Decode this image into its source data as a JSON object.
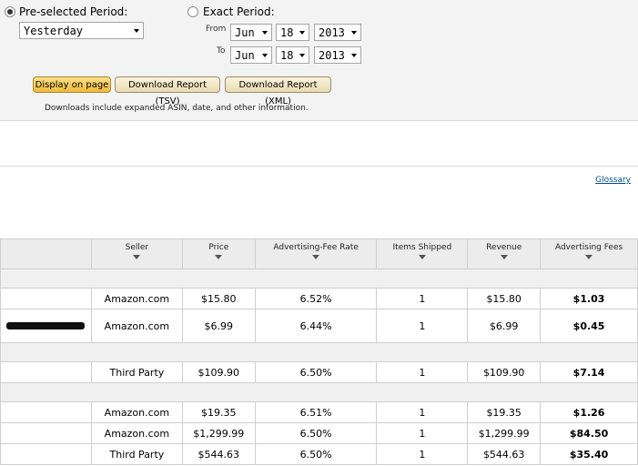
{
  "period": {
    "preselected_label": "Pre-selected Period:",
    "preselected_value": "Yesterday",
    "exact_label": "Exact Period:",
    "from_label": "From",
    "to_label": "To",
    "from": {
      "month": "Jun",
      "day": "18",
      "year": "2013"
    },
    "to": {
      "month": "Jun",
      "day": "18",
      "year": "2013"
    }
  },
  "buttons": {
    "display": "Display on page",
    "tsv": "Download Report (TSV)",
    "xml": "Download Report (XML)"
  },
  "note": "Downloads include expanded ASIN, date, and other information.",
  "glossary": "Glossary",
  "table": {
    "headers": [
      "Seller",
      "Price",
      "Advertising-Fee Rate",
      "Items Shipped",
      "Revenue",
      "Advertising Fees"
    ],
    "rows": [
      [
        "Amazon.com",
        "$15.80",
        "6.52%",
        "1",
        "$15.80",
        "$1.03"
      ],
      [
        "Amazon.com",
        "$6.99",
        "6.44%",
        "1",
        "$6.99",
        "$0.45"
      ],
      [
        "Third Party",
        "$109.90",
        "6.50%",
        "1",
        "$109.90",
        "$7.14"
      ],
      [
        "Amazon.com",
        "$19.35",
        "6.51%",
        "1",
        "$19.35",
        "$1.26"
      ],
      [
        "Amazon.com",
        "$1,299.99",
        "6.50%",
        "1",
        "$1,299.99",
        "$84.50"
      ],
      [
        "Third Party",
        "$544.63",
        "6.50%",
        "1",
        "$544.63",
        "$35.40"
      ]
    ]
  }
}
